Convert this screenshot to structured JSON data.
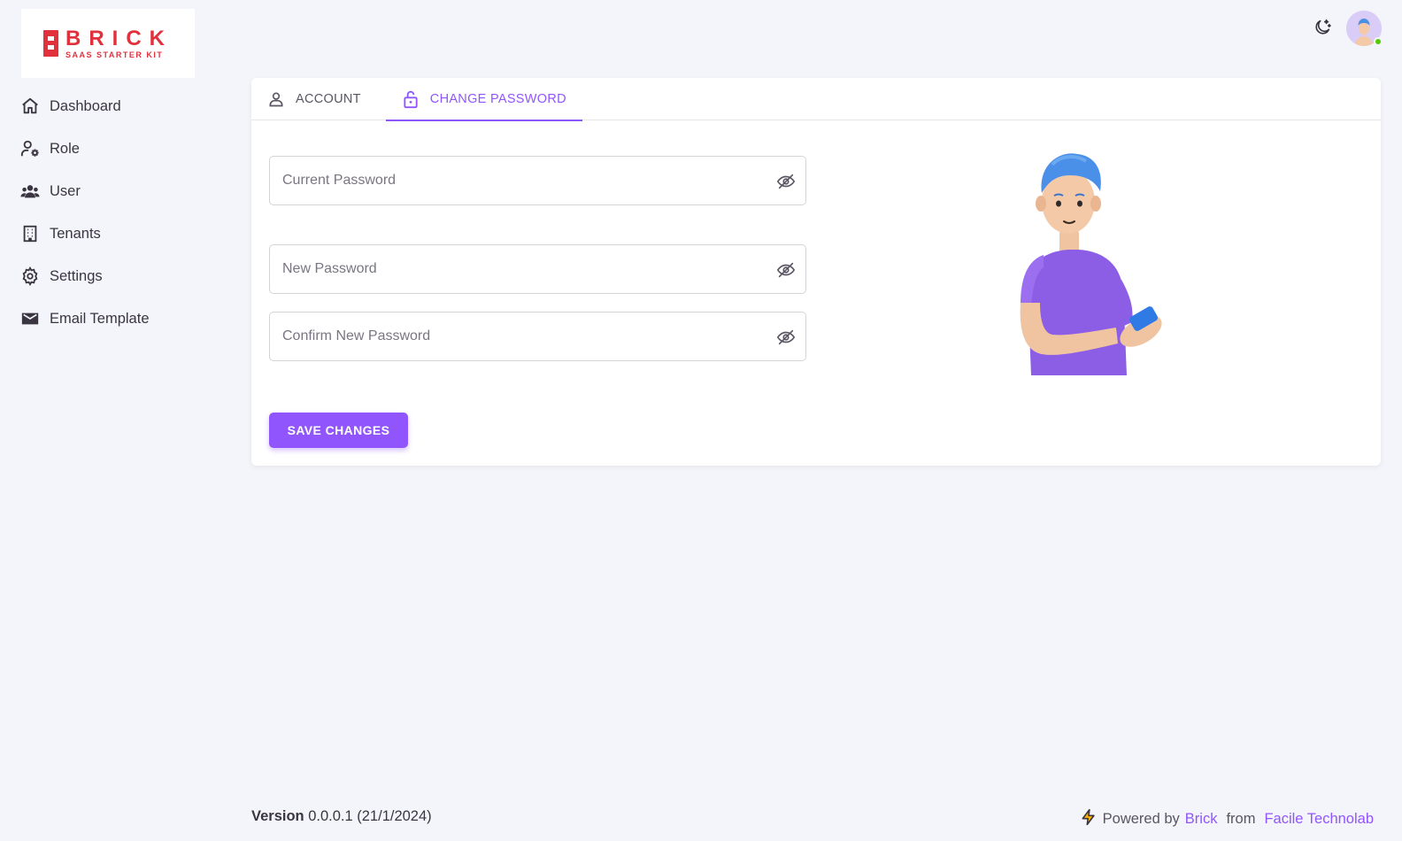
{
  "brand": {
    "title": "BRICK",
    "subtitle": "SAAS STARTER KIT",
    "color": "#e0313d"
  },
  "sidebar": {
    "items": [
      {
        "label": "Dashboard",
        "icon": "home-icon"
      },
      {
        "label": "Role",
        "icon": "user-cog-icon"
      },
      {
        "label": "User",
        "icon": "users-icon"
      },
      {
        "label": "Tenants",
        "icon": "building-icon"
      },
      {
        "label": "Settings",
        "icon": "gear-icon"
      },
      {
        "label": "Email Template",
        "icon": "email-icon"
      }
    ]
  },
  "header": {
    "theme_icon": "moon-stars-icon",
    "avatar_status": "online"
  },
  "tabs": [
    {
      "label": "ACCOUNT",
      "icon": "user-outline-icon",
      "active": false
    },
    {
      "label": "CHANGE PASSWORD",
      "icon": "lock-open-icon",
      "active": true
    }
  ],
  "form": {
    "current_password": {
      "placeholder": "Current Password",
      "value": ""
    },
    "new_password": {
      "placeholder": "New Password",
      "value": ""
    },
    "confirm_password": {
      "placeholder": "Confirm New Password",
      "value": ""
    },
    "save_label": "SAVE CHANGES"
  },
  "footer": {
    "version_label": "Version",
    "version_value": "0.0.0.1 (21/1/2024)",
    "powered_by": "Powered by",
    "brick_link": "Brick",
    "from": "from",
    "company_link": "Facile Technolab"
  },
  "colors": {
    "primary": "#9155fd",
    "background": "#f4f5fa",
    "online": "#56ca00"
  }
}
